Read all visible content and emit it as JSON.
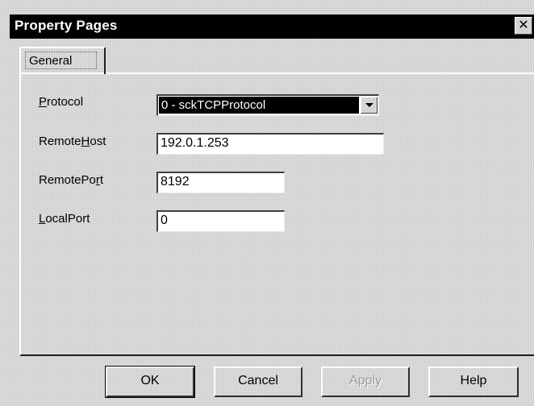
{
  "window": {
    "title": "Property Pages",
    "close_glyph": "✕"
  },
  "tabs": [
    {
      "label": "General",
      "selected": true
    }
  ],
  "fields": {
    "protocol": {
      "label_pre": "",
      "label_u": "P",
      "label_post": "rotocol",
      "value": "0 - sckTCPProtocol"
    },
    "remote_host": {
      "label_pre": "Remote",
      "label_u": "H",
      "label_post": "ost",
      "value": "192.0.1.253"
    },
    "remote_port": {
      "label_pre": "RemotePo",
      "label_u": "r",
      "label_post": "t",
      "value": "8192"
    },
    "local_port": {
      "label_pre": "",
      "label_u": "L",
      "label_post": "ocalPort",
      "value": "0"
    }
  },
  "buttons": {
    "ok": "OK",
    "cancel": "Cancel",
    "apply": "Apply",
    "help": "Help"
  },
  "icons": {
    "close": "close-icon",
    "dropdown": "chevron-down-icon"
  }
}
